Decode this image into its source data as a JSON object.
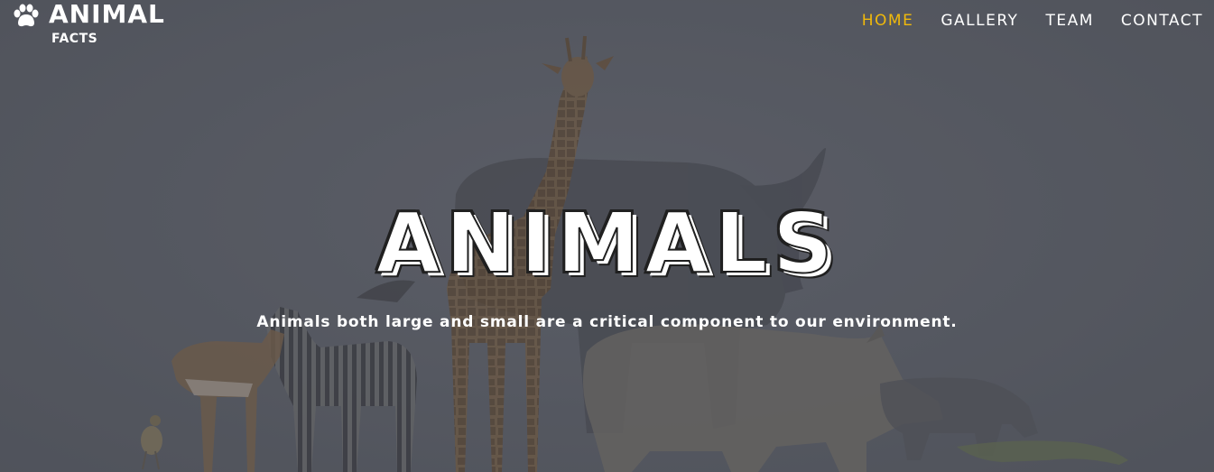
{
  "brand": {
    "title": "ANIMAL",
    "subtitle": "FACTS",
    "icon": "paw-icon"
  },
  "nav": {
    "items": [
      {
        "label": "HOME",
        "active": true
      },
      {
        "label": "GALLERY",
        "active": false
      },
      {
        "label": "TEAM",
        "active": false
      },
      {
        "label": "CONTACT",
        "active": false
      }
    ]
  },
  "hero": {
    "title": "ANIMALS",
    "subtitle": "Animals both large and small are a critical component to our environment."
  },
  "colors": {
    "active_nav": "#f0b90b",
    "text": "#ffffff",
    "overlay": "#575a63"
  }
}
